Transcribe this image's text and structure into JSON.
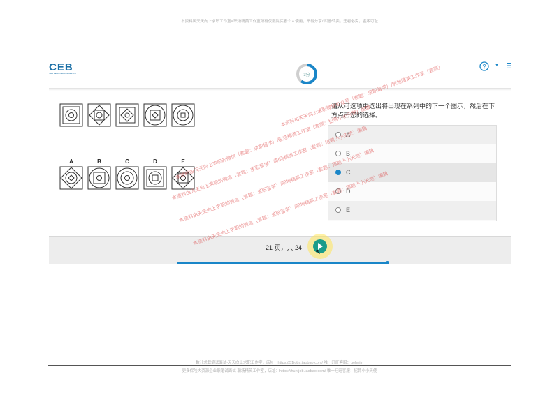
{
  "document": {
    "header_text": "本资料属天天向上求职工作室&职场精英工作室所有仅限购买者个人使用，不得分享/转赠/转卖，违者必究，盗版可耻",
    "footer_line1": "数计求职笔试面试-天天向上求职工作室，店址：https://51jobs.taobao.com/ 唯一旺旺客服：gelerjin",
    "footer_line2": "更多保险大资源企业职笔试面试-职场精英工作室，店址：https://huntjob.taobao.com/ 唯一旺旺客服：招聘小小天使"
  },
  "app": {
    "logo": "CEB",
    "logo_sub": "THE BEST PERFORMANCE",
    "timer_text": "3分",
    "timer_progress": 0.6,
    "help_icon": "help-circle-icon",
    "colors": {
      "accent": "#1a86c8",
      "next_button": "#1a9c8a",
      "watermark": "#dc3c3c"
    }
  },
  "puzzle": {
    "option_letters": [
      "A",
      "B",
      "C",
      "D",
      "E"
    ]
  },
  "question": {
    "text": "请从可选项中选出将出现在系列中的下一个图示，然后在下方点击您的选择。"
  },
  "choices": [
    {
      "label": "A",
      "selected": false
    },
    {
      "label": "B",
      "selected": false
    },
    {
      "label": "C",
      "selected": true
    },
    {
      "label": "D",
      "selected": false
    },
    {
      "label": "E",
      "selected": false
    }
  ],
  "footer": {
    "page_info": "21 页，共 24",
    "next_icon": "play-icon"
  },
  "watermarks": [
    "本资料由天天向上求职微信公众号（套题：求职留学）/职场精英工作室（套题）",
    "本资料由天天向上求职的微信（套题：求职留学）/职场精英工作室（套题：招聘小小天使）编辑",
    "本资料由天天向上求职的微信（套题：求职留学）/职场精英工作室（套题：招聘小小天使）编辑",
    "本资料由天天向上求职的微信（套题：求职留学）/职场精英工作室（套题：招聘小小天使）编辑",
    "本资料由天天向上求职的微信（套题：求职留学）/职场精英工作室（套题：招聘小小天使）编辑"
  ]
}
